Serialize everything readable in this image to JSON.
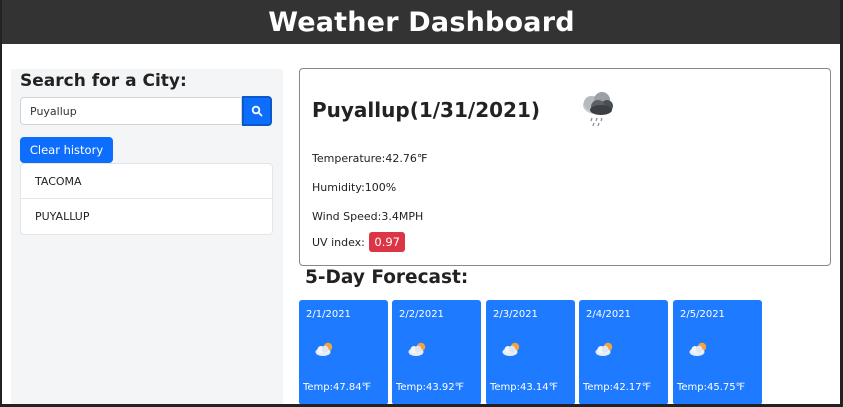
{
  "header": {
    "title": "Weather Dashboard"
  },
  "sidebar": {
    "heading": "Search for a City:",
    "search": {
      "value": "Puyallup"
    },
    "search_button_icon": "search-icon",
    "clear_button_label": "Clear history",
    "history": [
      {
        "label": "TACOMA"
      },
      {
        "label": "PUYALLUP"
      }
    ]
  },
  "current": {
    "title": "Puyallup(1/31/2021)",
    "icon": "rain-cloud-icon",
    "temperature": "Temperature:42.76℉",
    "humidity": "Humidity:100%",
    "wind": "Wind Speed:3.4MPH",
    "uv_label": "UV index:",
    "uv_value": "0.97",
    "uv_color": "#dc3545"
  },
  "forecast": {
    "title": "5-Day Forecast:",
    "card_color": "#1e7bff",
    "days": [
      {
        "date": "2/1/2021",
        "icon": "cloud-sun-icon",
        "temp": "Temp:47.84℉"
      },
      {
        "date": "2/2/2021",
        "icon": "cloud-sun-icon",
        "temp": "Temp:43.92℉"
      },
      {
        "date": "2/3/2021",
        "icon": "cloud-sun-icon",
        "temp": "Temp:43.14℉"
      },
      {
        "date": "2/4/2021",
        "icon": "cloud-sun-icon",
        "temp": "Temp:42.17℉"
      },
      {
        "date": "2/5/2021",
        "icon": "cloud-sun-icon",
        "temp": "Temp:45.75℉"
      }
    ]
  }
}
